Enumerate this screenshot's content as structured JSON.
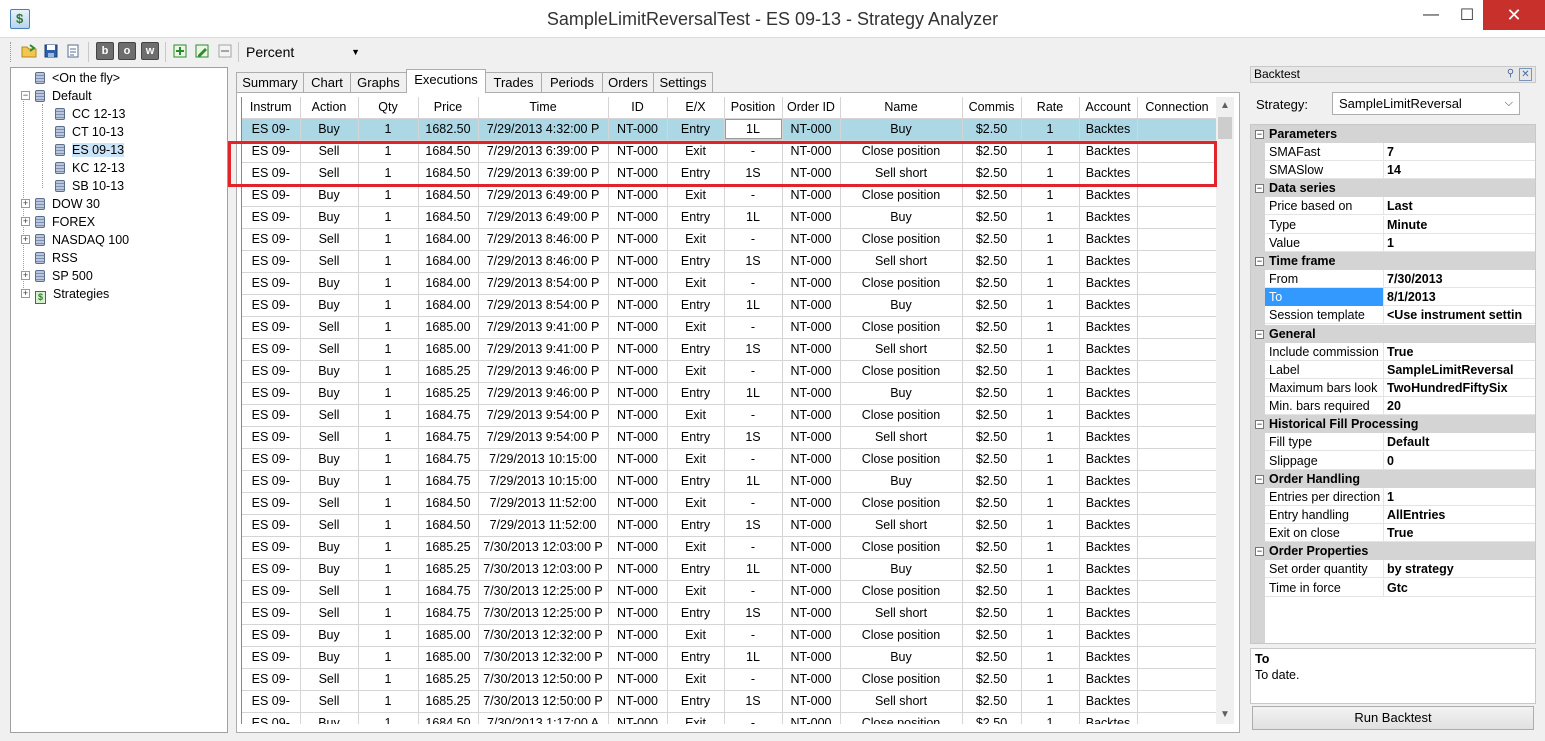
{
  "window": {
    "title": "SampleLimitReversalTest - ES 09-13 - Strategy Analyzer",
    "minimize": "—",
    "maximize": "☐",
    "close": "✕"
  },
  "toolbar": {
    "letters": [
      "b",
      "o",
      "w"
    ],
    "percent": "Percent"
  },
  "tree": {
    "items": [
      {
        "label": "<On the fly>"
      },
      {
        "label": "Default",
        "expander": "−"
      },
      {
        "label": "CC 12-13"
      },
      {
        "label": "CT 10-13"
      },
      {
        "label": "ES 09-13"
      },
      {
        "label": "KC 12-13"
      },
      {
        "label": "SB 10-13"
      },
      {
        "label": "DOW 30",
        "expander": "+"
      },
      {
        "label": "FOREX",
        "expander": "+"
      },
      {
        "label": "NASDAQ 100",
        "expander": "+"
      },
      {
        "label": "RSS"
      },
      {
        "label": "SP 500",
        "expander": "+"
      },
      {
        "label": "Strategies",
        "expander": "+"
      }
    ]
  },
  "tabs": [
    "Summary",
    "Chart",
    "Graphs",
    "Executions",
    "Trades",
    "Periods",
    "Orders",
    "Settings"
  ],
  "grid": {
    "columns": [
      "Instrum",
      "Action",
      "Qty",
      "Price",
      "Time",
      "ID",
      "E/X",
      "Position",
      "Order ID",
      "Name",
      "Commis",
      "Rate",
      "Account",
      "Connection"
    ],
    "rows": [
      [
        "ES 09-",
        "Buy",
        "1",
        "1682.50",
        "7/29/2013 4:32:00 P",
        "NT-000",
        "Entry",
        "1L",
        "NT-000",
        "Buy",
        "$2.50",
        "1",
        "Backtes",
        ""
      ],
      [
        "ES 09-",
        "Sell",
        "1",
        "1684.50",
        "7/29/2013 6:39:00 P",
        "NT-000",
        "Exit",
        "-",
        "NT-000",
        "Close position",
        "$2.50",
        "1",
        "Backtes",
        ""
      ],
      [
        "ES 09-",
        "Sell",
        "1",
        "1684.50",
        "7/29/2013 6:39:00 P",
        "NT-000",
        "Entry",
        "1S",
        "NT-000",
        "Sell short",
        "$2.50",
        "1",
        "Backtes",
        ""
      ],
      [
        "ES 09-",
        "Buy",
        "1",
        "1684.50",
        "7/29/2013 6:49:00 P",
        "NT-000",
        "Exit",
        "-",
        "NT-000",
        "Close position",
        "$2.50",
        "1",
        "Backtes",
        ""
      ],
      [
        "ES 09-",
        "Buy",
        "1",
        "1684.50",
        "7/29/2013 6:49:00 P",
        "NT-000",
        "Entry",
        "1L",
        "NT-000",
        "Buy",
        "$2.50",
        "1",
        "Backtes",
        ""
      ],
      [
        "ES 09-",
        "Sell",
        "1",
        "1684.00",
        "7/29/2013 8:46:00 P",
        "NT-000",
        "Exit",
        "-",
        "NT-000",
        "Close position",
        "$2.50",
        "1",
        "Backtes",
        ""
      ],
      [
        "ES 09-",
        "Sell",
        "1",
        "1684.00",
        "7/29/2013 8:46:00 P",
        "NT-000",
        "Entry",
        "1S",
        "NT-000",
        "Sell short",
        "$2.50",
        "1",
        "Backtes",
        ""
      ],
      [
        "ES 09-",
        "Buy",
        "1",
        "1684.00",
        "7/29/2013 8:54:00 P",
        "NT-000",
        "Exit",
        "-",
        "NT-000",
        "Close position",
        "$2.50",
        "1",
        "Backtes",
        ""
      ],
      [
        "ES 09-",
        "Buy",
        "1",
        "1684.00",
        "7/29/2013 8:54:00 P",
        "NT-000",
        "Entry",
        "1L",
        "NT-000",
        "Buy",
        "$2.50",
        "1",
        "Backtes",
        ""
      ],
      [
        "ES 09-",
        "Sell",
        "1",
        "1685.00",
        "7/29/2013 9:41:00 P",
        "NT-000",
        "Exit",
        "-",
        "NT-000",
        "Close position",
        "$2.50",
        "1",
        "Backtes",
        ""
      ],
      [
        "ES 09-",
        "Sell",
        "1",
        "1685.00",
        "7/29/2013 9:41:00 P",
        "NT-000",
        "Entry",
        "1S",
        "NT-000",
        "Sell short",
        "$2.50",
        "1",
        "Backtes",
        ""
      ],
      [
        "ES 09-",
        "Buy",
        "1",
        "1685.25",
        "7/29/2013 9:46:00 P",
        "NT-000",
        "Exit",
        "-",
        "NT-000",
        "Close position",
        "$2.50",
        "1",
        "Backtes",
        ""
      ],
      [
        "ES 09-",
        "Buy",
        "1",
        "1685.25",
        "7/29/2013 9:46:00 P",
        "NT-000",
        "Entry",
        "1L",
        "NT-000",
        "Buy",
        "$2.50",
        "1",
        "Backtes",
        ""
      ],
      [
        "ES 09-",
        "Sell",
        "1",
        "1684.75",
        "7/29/2013 9:54:00 P",
        "NT-000",
        "Exit",
        "-",
        "NT-000",
        "Close position",
        "$2.50",
        "1",
        "Backtes",
        ""
      ],
      [
        "ES 09-",
        "Sell",
        "1",
        "1684.75",
        "7/29/2013 9:54:00 P",
        "NT-000",
        "Entry",
        "1S",
        "NT-000",
        "Sell short",
        "$2.50",
        "1",
        "Backtes",
        ""
      ],
      [
        "ES 09-",
        "Buy",
        "1",
        "1684.75",
        "7/29/2013 10:15:00",
        "NT-000",
        "Exit",
        "-",
        "NT-000",
        "Close position",
        "$2.50",
        "1",
        "Backtes",
        ""
      ],
      [
        "ES 09-",
        "Buy",
        "1",
        "1684.75",
        "7/29/2013 10:15:00",
        "NT-000",
        "Entry",
        "1L",
        "NT-000",
        "Buy",
        "$2.50",
        "1",
        "Backtes",
        ""
      ],
      [
        "ES 09-",
        "Sell",
        "1",
        "1684.50",
        "7/29/2013 11:52:00",
        "NT-000",
        "Exit",
        "-",
        "NT-000",
        "Close position",
        "$2.50",
        "1",
        "Backtes",
        ""
      ],
      [
        "ES 09-",
        "Sell",
        "1",
        "1684.50",
        "7/29/2013 11:52:00",
        "NT-000",
        "Entry",
        "1S",
        "NT-000",
        "Sell short",
        "$2.50",
        "1",
        "Backtes",
        ""
      ],
      [
        "ES 09-",
        "Buy",
        "1",
        "1685.25",
        "7/30/2013 12:03:00 P",
        "NT-000",
        "Exit",
        "-",
        "NT-000",
        "Close position",
        "$2.50",
        "1",
        "Backtes",
        ""
      ],
      [
        "ES 09-",
        "Buy",
        "1",
        "1685.25",
        "7/30/2013 12:03:00 P",
        "NT-000",
        "Entry",
        "1L",
        "NT-000",
        "Buy",
        "$2.50",
        "1",
        "Backtes",
        ""
      ],
      [
        "ES 09-",
        "Sell",
        "1",
        "1684.75",
        "7/30/2013 12:25:00 P",
        "NT-000",
        "Exit",
        "-",
        "NT-000",
        "Close position",
        "$2.50",
        "1",
        "Backtes",
        ""
      ],
      [
        "ES 09-",
        "Sell",
        "1",
        "1684.75",
        "7/30/2013 12:25:00 P",
        "NT-000",
        "Entry",
        "1S",
        "NT-000",
        "Sell short",
        "$2.50",
        "1",
        "Backtes",
        ""
      ],
      [
        "ES 09-",
        "Buy",
        "1",
        "1685.00",
        "7/30/2013 12:32:00 P",
        "NT-000",
        "Exit",
        "-",
        "NT-000",
        "Close position",
        "$2.50",
        "1",
        "Backtes",
        ""
      ],
      [
        "ES 09-",
        "Buy",
        "1",
        "1685.00",
        "7/30/2013 12:32:00 P",
        "NT-000",
        "Entry",
        "1L",
        "NT-000",
        "Buy",
        "$2.50",
        "1",
        "Backtes",
        ""
      ],
      [
        "ES 09-",
        "Sell",
        "1",
        "1685.25",
        "7/30/2013 12:50:00 P",
        "NT-000",
        "Exit",
        "-",
        "NT-000",
        "Close position",
        "$2.50",
        "1",
        "Backtes",
        ""
      ],
      [
        "ES 09-",
        "Sell",
        "1",
        "1685.25",
        "7/30/2013 12:50:00 P",
        "NT-000",
        "Entry",
        "1S",
        "NT-000",
        "Sell short",
        "$2.50",
        "1",
        "Backtes",
        ""
      ],
      [
        "ES 09-",
        "Buy",
        "1",
        "1684.50",
        "7/30/2013 1:17:00 A",
        "NT-000",
        "Exit",
        "-",
        "NT-000",
        "Close position",
        "$2.50",
        "1",
        "Backtes",
        ""
      ]
    ]
  },
  "backtest": {
    "header": "Backtest",
    "strategy_label": "Strategy:",
    "strategy_value": "SampleLimitReversal",
    "categories": [
      {
        "name": "Parameters",
        "rows": [
          [
            "SMAFast",
            "7"
          ],
          [
            "SMASlow",
            "14"
          ]
        ]
      },
      {
        "name": "Data series",
        "rows": [
          [
            "Price based on",
            "Last"
          ],
          [
            "Type",
            "Minute"
          ],
          [
            "Value",
            "1"
          ]
        ]
      },
      {
        "name": "Time frame",
        "rows": [
          [
            "From",
            "7/30/2013"
          ],
          [
            "To",
            "8/1/2013"
          ],
          [
            "Session template",
            "<Use instrument settin"
          ]
        ]
      },
      {
        "name": "General",
        "rows": [
          [
            "Include commission",
            "True"
          ],
          [
            "Label",
            "SampleLimitReversal"
          ],
          [
            "Maximum bars look",
            "TwoHundredFiftySix"
          ],
          [
            "Min. bars required",
            "20"
          ]
        ]
      },
      {
        "name": "Historical Fill Processing",
        "rows": [
          [
            "Fill type",
            "Default"
          ],
          [
            "Slippage",
            "0"
          ]
        ]
      },
      {
        "name": "Order Handling",
        "rows": [
          [
            "Entries per direction",
            "1"
          ],
          [
            "Entry handling",
            "AllEntries"
          ],
          [
            "Exit on close",
            "True"
          ]
        ]
      },
      {
        "name": "Order Properties",
        "rows": [
          [
            "Set order quantity",
            "by strategy"
          ],
          [
            "Time in force",
            "Gtc"
          ]
        ]
      }
    ],
    "description_title": "To",
    "description_text": "To date.",
    "run_button": "Run Backtest"
  },
  "colors": {
    "selected_row": "#acd8e6",
    "highlight_box": "#e0242b",
    "close_button": "#c7302b"
  }
}
